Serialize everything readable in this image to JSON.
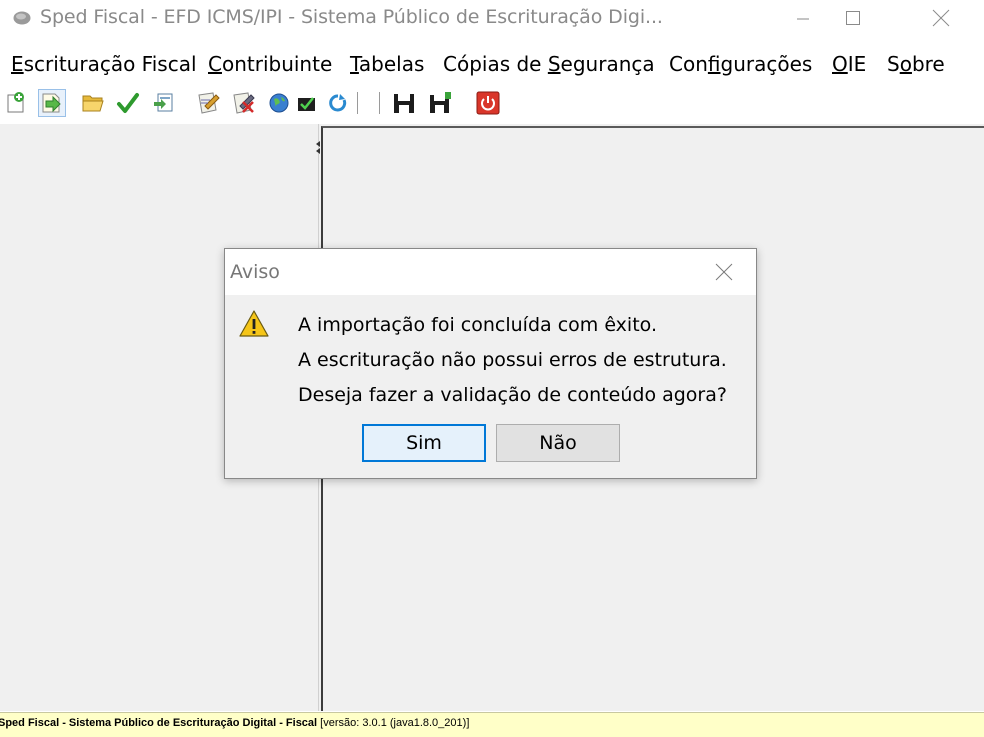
{
  "window": {
    "title": "Sped Fiscal - EFD ICMS/IPI - Sistema Público de Escrituração Digi...",
    "icons": [
      "app-icon",
      "minimize-icon",
      "maximize-icon",
      "close-icon"
    ]
  },
  "menu": {
    "items": [
      {
        "pre": "",
        "ul": "E",
        "post": "scrituração Fiscal"
      },
      {
        "pre": "",
        "ul": "C",
        "post": "ontribuinte"
      },
      {
        "pre": "",
        "ul": "T",
        "post": "abelas"
      },
      {
        "pre": "Cópias de ",
        "ul": "S",
        "post": "egurança"
      },
      {
        "pre": "Con",
        "ul": "f",
        "post": "igurações"
      },
      {
        "pre": "",
        "ul": "O",
        "post": "IE"
      },
      {
        "pre": "S",
        "ul": "o",
        "post": "bre"
      }
    ]
  },
  "toolbar": {
    "buttons": [
      "new-file-icon",
      "import-icon",
      "open-folder-icon",
      "validate-check-icon",
      "export-icon",
      "sign-icon",
      "remove-signature-icon",
      "transmit-globe-icon",
      "receipt-icon",
      "refresh-icon",
      "save-icon",
      "save-as-icon",
      "exit-power-icon"
    ]
  },
  "dialog": {
    "title": "Aviso",
    "icon": "warning-icon",
    "lines": [
      "A importação foi concluída com êxito.",
      "A escrituração não possui erros de estrutura.",
      "Deseja fazer a validação de conteúdo agora?"
    ],
    "buttons": {
      "yes": "Sim",
      "no": "Não"
    }
  },
  "statusbar": {
    "bold": "Sped Fiscal - Sistema Público de Escrituração Digital - Fiscal",
    "normal": " [versão: 3.0.1 (java1.8.0_201)]"
  },
  "colors": {
    "statusbar_bg": "#ffffc8",
    "default_button_border": "#0078d7",
    "warning_yellow": "#f5c518",
    "exit_red": "#d9362a"
  }
}
